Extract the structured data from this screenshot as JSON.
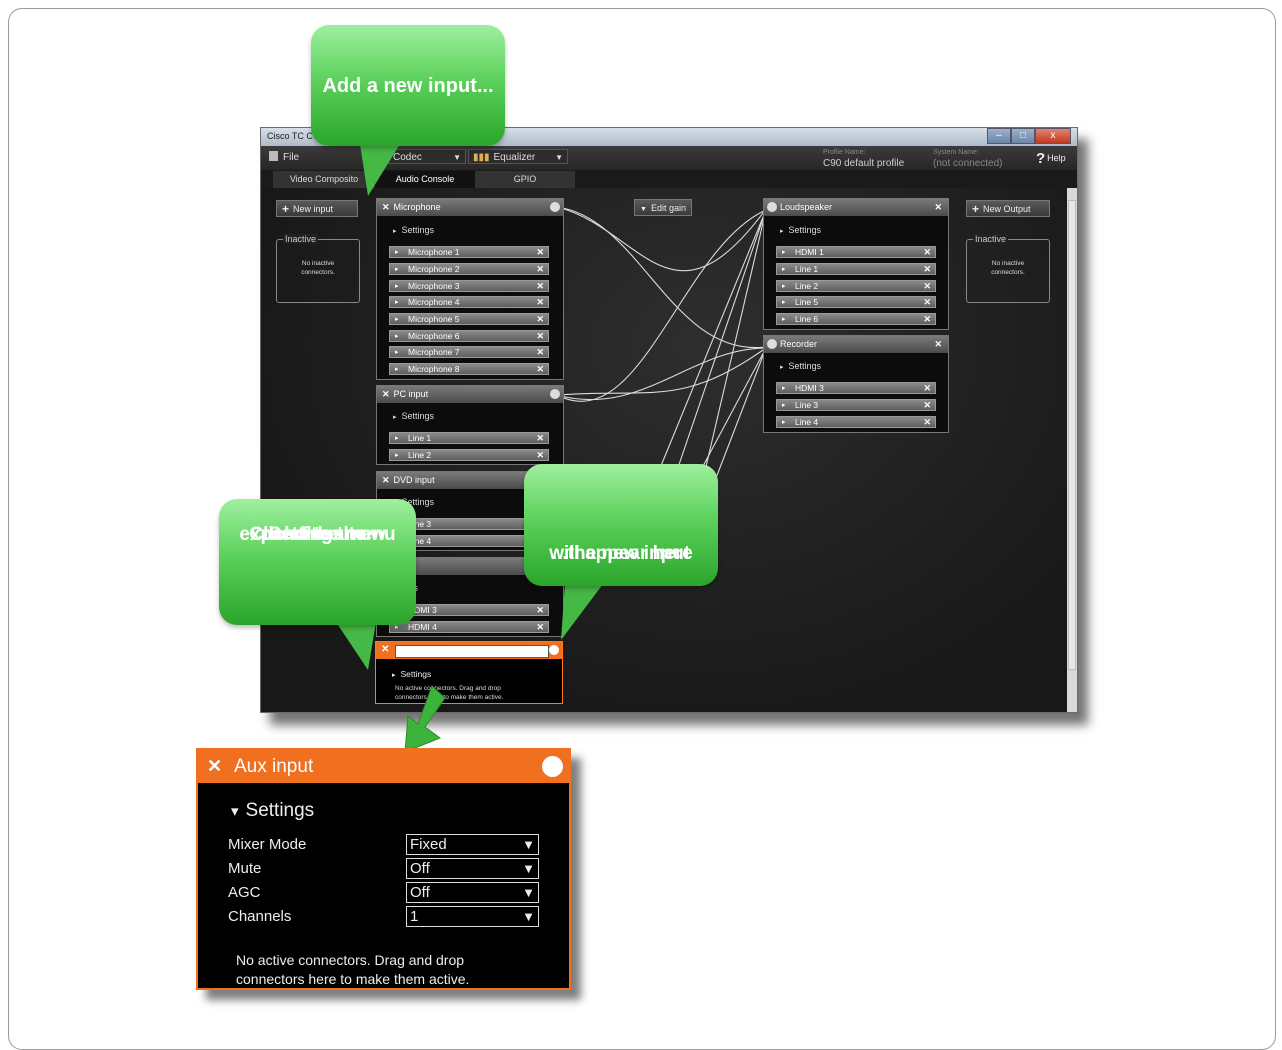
{
  "callouts": {
    "add_input": "Add a new input...",
    "click_arrow": [
      "Click the arrow",
      "next to the",
      "Settings to",
      "expand the menu"
    ],
    "new_input_here": [
      "...the new input",
      "will appear here"
    ]
  },
  "window": {
    "title": "Cisco TC C",
    "buttons": {
      "minimize": "–",
      "maximize": "□",
      "close": "x"
    }
  },
  "menubar": {
    "file": "File",
    "codec": "Codec",
    "equalizer": "Equalizer",
    "profile_label": "Profile Name:",
    "profile_value": "C90 default profile",
    "system_label": "System Name:",
    "system_value": "(not connected)",
    "help": "Help"
  },
  "tabs": [
    "Video Composito",
    "Audio Console",
    "GPIO"
  ],
  "toolbar": {
    "new_input": "New input",
    "edit_gain": "Edit gain",
    "new_output": "New Output"
  },
  "inactive": {
    "label": "Inactive",
    "message_line1": "No inactive",
    "message_line2": "connectors."
  },
  "inputs": [
    {
      "title": "Microphone",
      "settings": "Settings",
      "connectors": [
        "Microphone 1",
        "Microphone 2",
        "Microphone 3",
        "Microphone 4",
        "Microphone 5",
        "Microphone 6",
        "Microphone 7",
        "Microphone 8"
      ]
    },
    {
      "title": "PC input",
      "settings": "Settings",
      "connectors": [
        "Line 1",
        "Line 2"
      ]
    },
    {
      "title": "DVD input",
      "settings": "Settings",
      "connectors": [
        "Line 3",
        "Line 4"
      ]
    },
    {
      "title": "input",
      "settings": "ings",
      "connectors": [
        "HDMI 3",
        "HDMI 4"
      ]
    }
  ],
  "outputs": [
    {
      "title": "Loudspeaker",
      "settings": "Settings",
      "connectors": [
        "HDMI 1",
        "Line 1",
        "Line 2",
        "Line 5",
        "Line 6"
      ]
    },
    {
      "title": "Recorder",
      "settings": "Settings",
      "connectors": [
        "HDMI 3",
        "Line 3",
        "Line 4"
      ]
    }
  ],
  "new_node": {
    "settings": "Settings",
    "message_line1": "No active connectors. Drag and drop",
    "message_line2": "connectors here to make them active."
  },
  "aux_panel": {
    "title": "Aux input",
    "settings": "Settings",
    "fields": [
      {
        "label": "Mixer Mode",
        "value": "Fixed"
      },
      {
        "label": "Mute",
        "value": "Off"
      },
      {
        "label": "AGC",
        "value": "Off"
      },
      {
        "label": "Channels",
        "value": "1"
      }
    ],
    "message_line1": "No active connectors. Drag and drop",
    "message_line2": "connectors here to make them active."
  },
  "colors": {
    "accent_orange": "#f07020",
    "callout_green": "#4cc24c"
  }
}
